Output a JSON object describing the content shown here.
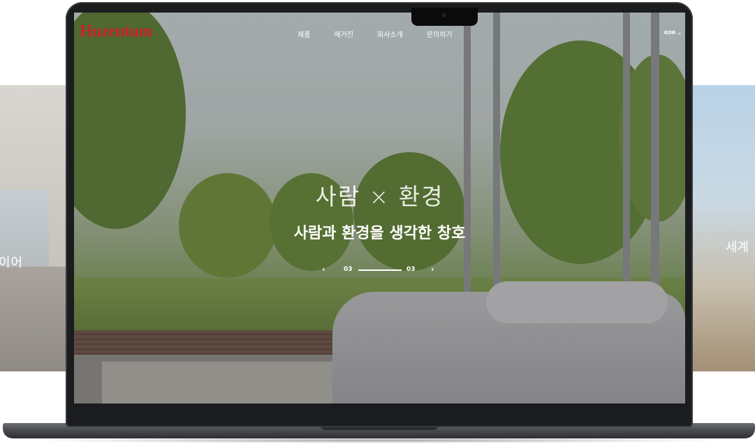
{
  "side_slides": {
    "left_text": "이어",
    "right_text": "세계"
  },
  "site": {
    "logo": "Huzentum",
    "nav": [
      "제품",
      "매거진",
      "회사소개",
      "문의하기"
    ],
    "language": "KOR",
    "language_icon": "chevron-down-icon"
  },
  "hero": {
    "title": "사람 × 환경",
    "subtitle": "사람과 환경을 생각한 창호",
    "pager": {
      "current": "03",
      "total": "03",
      "progress": 1.0,
      "prev_icon": "chevron-left-icon",
      "next_icon": "chevron-right-icon"
    }
  },
  "colors": {
    "logo": "#c8232c",
    "laptop": "#1b1c1e",
    "text": "#ffffff"
  }
}
